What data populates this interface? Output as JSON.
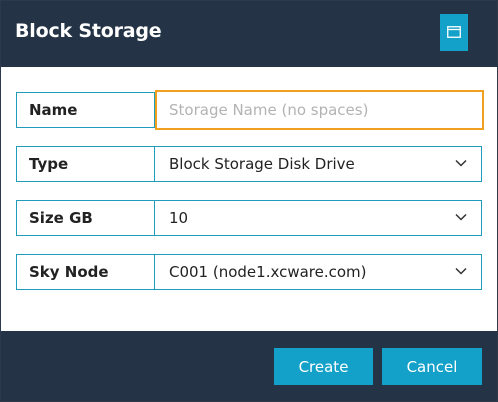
{
  "dialog": {
    "title": "Block Storage",
    "maximize_icon": "window-maximize-icon"
  },
  "form": {
    "name": {
      "label": "Name",
      "value": "",
      "placeholder": "Storage Name (no spaces)"
    },
    "type": {
      "label": "Type",
      "value": "Block Storage Disk Drive"
    },
    "size": {
      "label": "Size GB",
      "value": "10"
    },
    "sky_node": {
      "label": "Sky Node",
      "value": "C001 (node1.xcware.com)"
    }
  },
  "footer": {
    "create_label": "Create",
    "cancel_label": "Cancel"
  },
  "colors": {
    "header_bg": "#243446",
    "accent": "#13a1c9",
    "focus_border": "#f0a020",
    "field_border": "#1f9bbb"
  }
}
